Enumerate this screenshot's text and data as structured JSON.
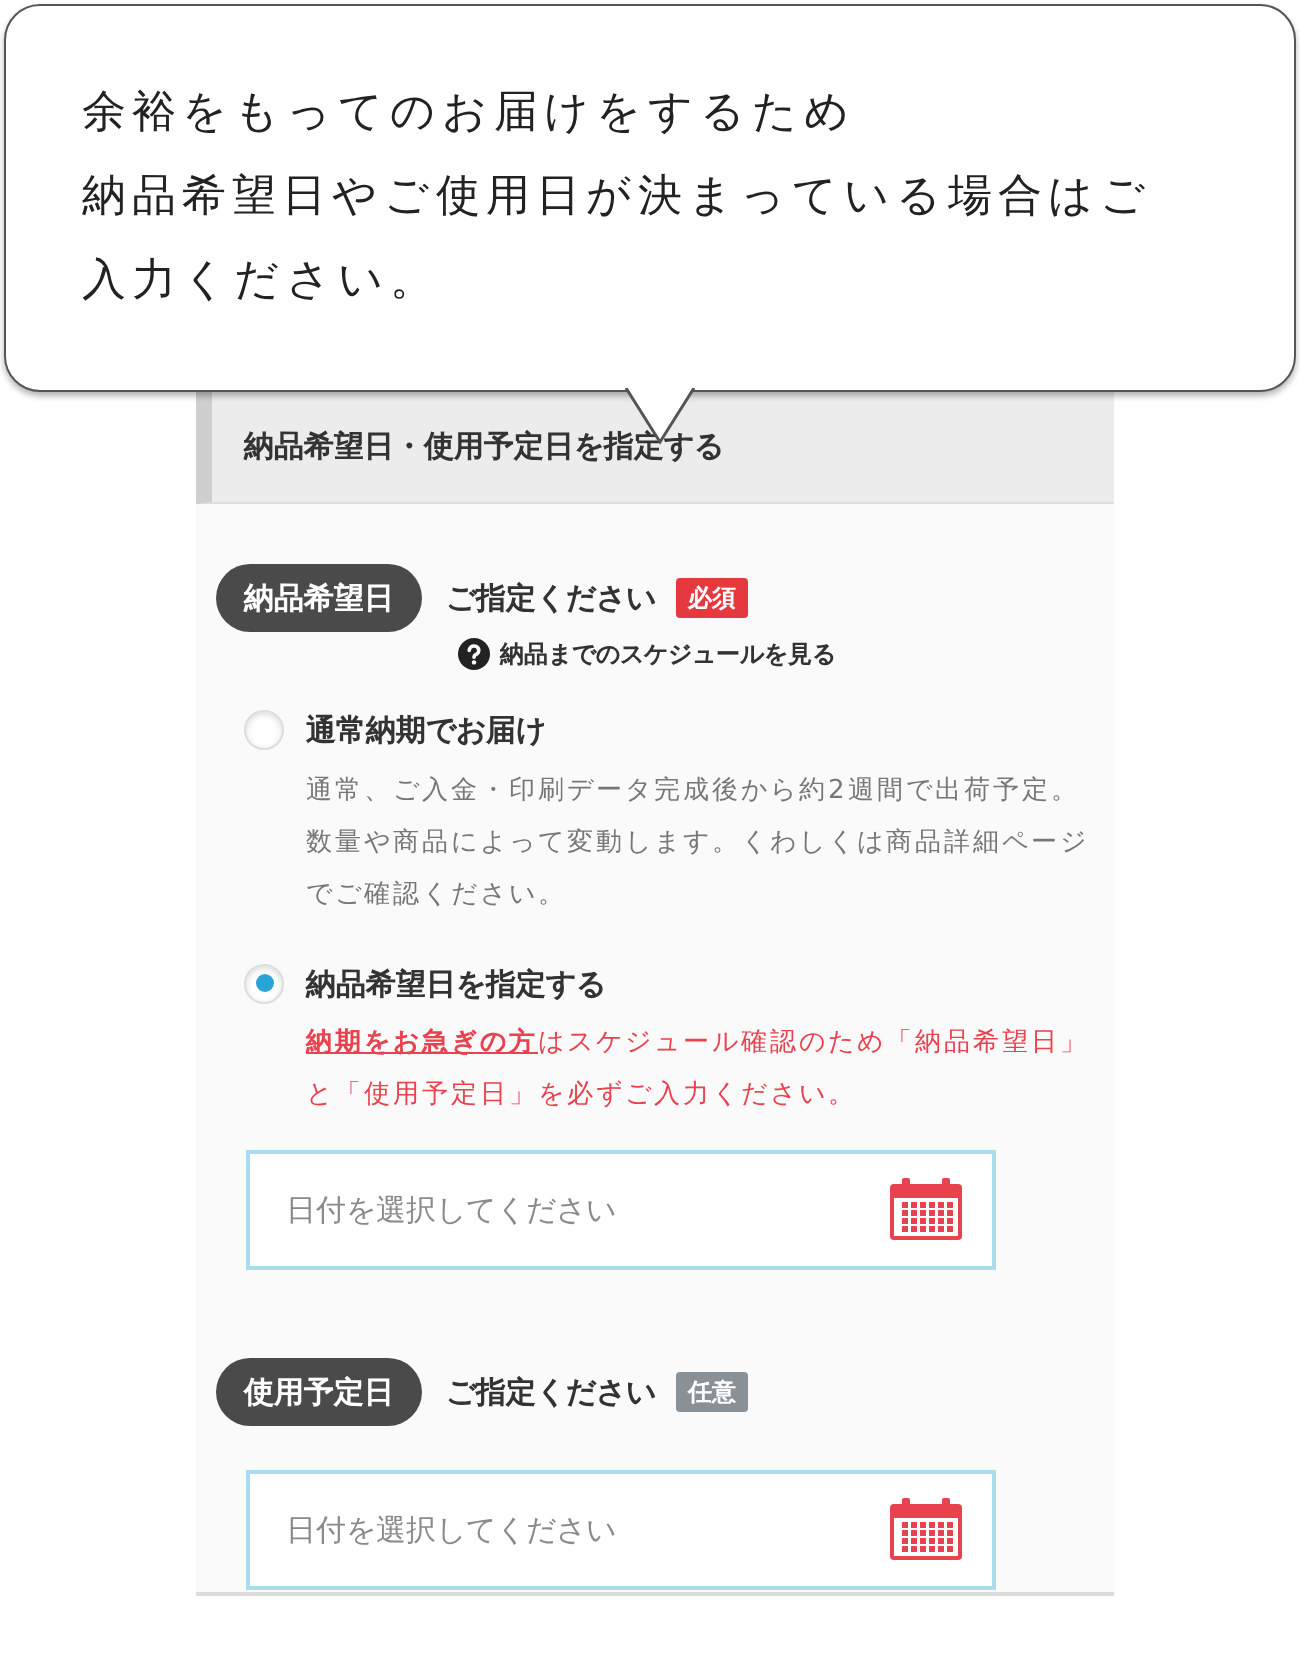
{
  "callout": {
    "lines": [
      "余裕をもってのお届けをするため",
      "納品希望日やご使用日が決まっている場合はご",
      "入力ください。"
    ]
  },
  "section": {
    "title": "納品希望日・使用予定日を指定する"
  },
  "delivery": {
    "label": "納品希望日",
    "prompt": "ご指定ください",
    "badge": {
      "text": "必須",
      "kind": "required"
    },
    "help_link": "納品までのスケジュールを見る",
    "options": [
      {
        "label": "通常納期でお届け",
        "selected": false,
        "description": "通常、ご入金・印刷データ完成後から約2週間で出荷予定。数量や商品によって変動します。くわしくは商品詳細ページでご確認ください。",
        "kind": "plain"
      },
      {
        "label": "納品希望日を指定する",
        "selected": true,
        "link": "納期をお急ぎの方",
        "description": "はスケジュール確認のため「納品希望日」と「使用予定日」を必ずご入力ください。",
        "kind": "warning"
      }
    ],
    "date_field": {
      "placeholder": "日付を選択してください"
    }
  },
  "usage": {
    "label": "使用予定日",
    "prompt": "ご指定ください",
    "badge": {
      "text": "任意",
      "kind": "optional"
    },
    "date_field": {
      "placeholder": "日付を選択してください"
    }
  }
}
